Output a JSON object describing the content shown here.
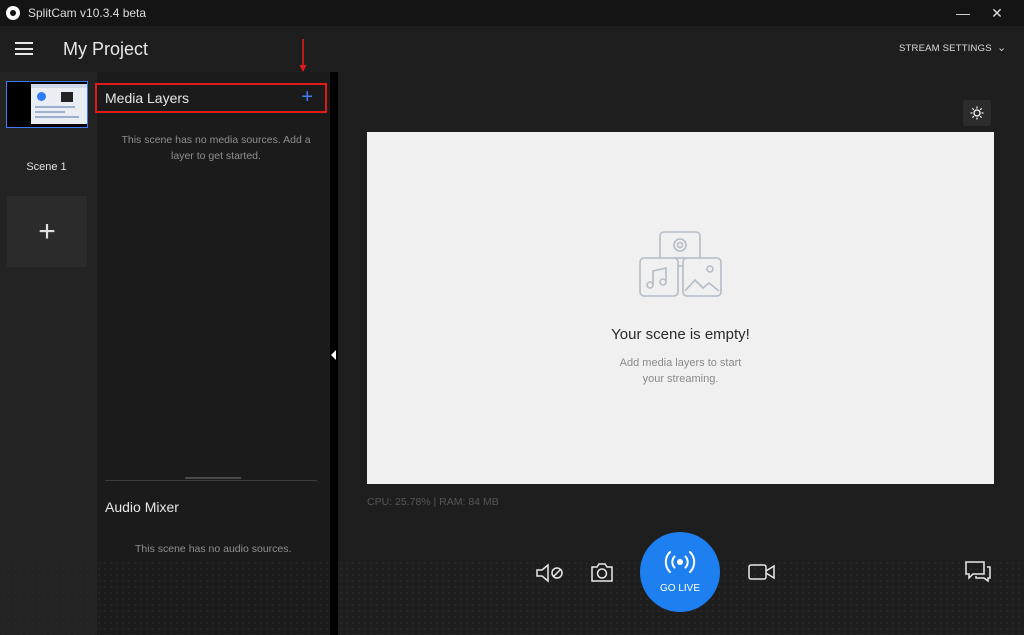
{
  "titlebar": {
    "title": "SplitCam v10.3.4 beta",
    "minimize": "—",
    "close": "✕"
  },
  "header": {
    "project_title": "My Project",
    "stream_settings": "STREAM SETTINGS",
    "chevron": "⌄"
  },
  "scenes": {
    "items": [
      {
        "label": "Scene 1"
      }
    ],
    "add_symbol": "+"
  },
  "media_layers": {
    "title": "Media Layers",
    "add_symbol": "+",
    "empty_text": "This scene has no media sources. Add a layer to get started."
  },
  "audio_mixer": {
    "title": "Audio Mixer",
    "empty_text": "This scene has no audio sources."
  },
  "preview": {
    "empty_title": "Your scene is empty!",
    "empty_subtitle_line1": "Add media layers to start",
    "empty_subtitle_line2": "your streaming."
  },
  "stats": {
    "text": "CPU: 25.78% | RAM: 84 MB"
  },
  "controls": {
    "go_live_label": "GO LIVE"
  },
  "colors": {
    "accent": "#1e7ff0",
    "highlight_box": "#e01b1b",
    "background": "#1e1e1f"
  },
  "icons": [
    "hamburger-icon",
    "chevron-down-icon",
    "plus-icon",
    "brightness-icon",
    "mic-muted-icon",
    "camera-icon",
    "broadcast-icon",
    "video-camera-icon",
    "chat-icon",
    "arrow-down-icon"
  ]
}
